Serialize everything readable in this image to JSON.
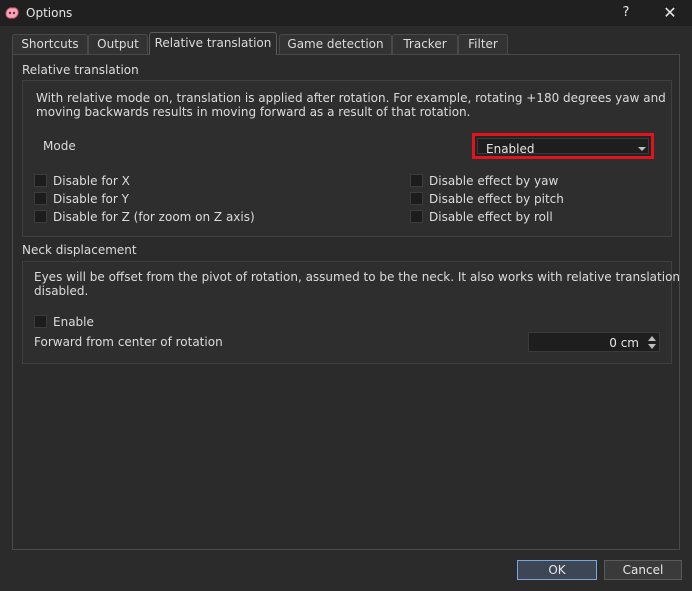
{
  "window": {
    "title": "Options",
    "help_label": "?",
    "close_label": "✕"
  },
  "tabs": [
    {
      "label": "Shortcuts"
    },
    {
      "label": "Output"
    },
    {
      "label": "Relative translation"
    },
    {
      "label": "Game detection"
    },
    {
      "label": "Tracker"
    },
    {
      "label": "Filter"
    }
  ],
  "relative": {
    "title": "Relative translation",
    "description_line1": "With relative mode on, translation is applied after rotation. For example, rotating +180 degrees yaw and",
    "description_line2": "moving backwards results in moving forward as a result of that rotation.",
    "mode_label": "Mode",
    "mode_value": "Enabled",
    "checks": [
      {
        "label": "Disable for X"
      },
      {
        "label": "Disable for Y"
      },
      {
        "label": "Disable for Z (for zoom on Z axis)"
      },
      {
        "label": "Disable effect by yaw"
      },
      {
        "label": "Disable effect by pitch"
      },
      {
        "label": "Disable effect by roll"
      }
    ]
  },
  "neck": {
    "title": "Neck displacement",
    "description_line1": "Eyes will be offset from the pivot of rotation, assumed to be the neck. It also works with relative translation",
    "description_line2": "disabled.",
    "enable_label": "Enable",
    "forward_label": "Forward from center of rotation",
    "forward_value": "0 cm"
  },
  "buttons": {
    "ok": "OK",
    "cancel": "Cancel"
  },
  "colors": {
    "highlight": "#e0141c",
    "background": "#2b2b2b"
  }
}
